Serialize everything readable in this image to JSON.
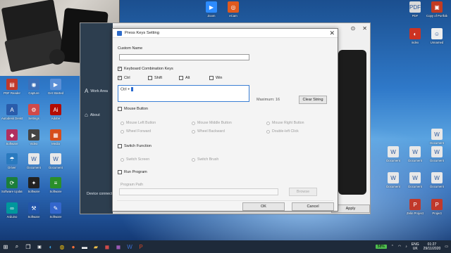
{
  "desktop": {
    "left_icons": [
      {
        "label": "PDF Reader",
        "color": "#c0392b",
        "glyph": "▤"
      },
      {
        "label": "Capture",
        "color": "#3d6fb8",
        "glyph": "◉"
      },
      {
        "label": "Get Started",
        "color": "#5b8fd6",
        "glyph": "▶"
      },
      {
        "label": "Autodesk Desktop App",
        "color": "#2a5caa",
        "glyph": "A"
      },
      {
        "label": "Settings",
        "color": "#d04a4a",
        "glyph": "⚙"
      },
      {
        "label": "Adobe",
        "color": "#b30b00",
        "glyph": "Ai"
      },
      {
        "label": "Software",
        "color": "#b03060",
        "glyph": "◆"
      },
      {
        "label": "Video",
        "color": "#444444",
        "glyph": "▶"
      },
      {
        "label": "Media",
        "color": "#d64e1c",
        "glyph": "▦"
      },
      {
        "label": "Driver",
        "color": "#2a7abf",
        "glyph": "☂"
      },
      {
        "label": "Document",
        "color": "#e8e8e8",
        "glyph": "W"
      },
      {
        "label": "Document",
        "color": "#e8e8e8",
        "glyph": "W"
      },
      {
        "label": "Software Update",
        "color": "#1b7e3b",
        "glyph": "⟳"
      },
      {
        "label": "Software",
        "color": "#222222",
        "glyph": "✦"
      },
      {
        "label": "Software",
        "color": "#2a8f2a",
        "glyph": "≡"
      },
      {
        "label": "Arduino",
        "color": "#00979c",
        "glyph": "∞"
      },
      {
        "label": "Software",
        "color": "#2255aa",
        "glyph": "⚒"
      },
      {
        "label": "Software",
        "color": "#3366cc",
        "glyph": "✎"
      }
    ],
    "right_icons": [
      {
        "label": "Zoom",
        "color": "#2d8cff",
        "glyph": "▶"
      },
      {
        "label": "eCam",
        "color": "#e05a1e",
        "glyph": "◎"
      },
      {
        "label": "PDF",
        "color": "#d9d9d9",
        "glyph": "PDF"
      },
      {
        "label": "Copy of Portfolio",
        "color": "#c23b22",
        "glyph": "▣"
      },
      {
        "label": "index",
        "color": "#cc3322",
        "glyph": "◐"
      },
      {
        "label": "Unnamed",
        "color": "#eeeeee",
        "glyph": "☺"
      },
      {
        "label": "Document",
        "color": "#e8e8e8",
        "glyph": "W"
      },
      {
        "label": "Document",
        "color": "#e8e8e8",
        "glyph": "W"
      },
      {
        "label": "Document",
        "color": "#e8e8e8",
        "glyph": "W"
      },
      {
        "label": "Document",
        "color": "#e8e8e8",
        "glyph": "W"
      },
      {
        "label": "Document",
        "color": "#e8e8e8",
        "glyph": "W"
      },
      {
        "label": "Document",
        "color": "#e8e8e8",
        "glyph": "W"
      },
      {
        "label": "Zelin Project",
        "color": "#c0392b",
        "glyph": "P"
      },
      {
        "label": "Project",
        "color": "#c0392b",
        "glyph": "P"
      },
      {
        "label": "Document",
        "color": "#e8e8e8",
        "glyph": "W"
      }
    ]
  },
  "background_app": {
    "sidebar_items": [
      {
        "label": "Work Area",
        "icon": "work-area-icon",
        "glyph": "A"
      },
      {
        "label": "About",
        "icon": "home-icon",
        "glyph": "⌂"
      }
    ],
    "footer_text": "Device connect",
    "apply_label": "Apply"
  },
  "dialog": {
    "title": "Press Keys Setting",
    "custom_name": {
      "label": "Custom Name",
      "value": ""
    },
    "keyboard_combo": {
      "label": "Keyboard Combination Keys",
      "modifiers": [
        {
          "label": "Ctrl",
          "checked": true
        },
        {
          "label": "Shift",
          "checked": false
        },
        {
          "label": "Alt",
          "checked": false
        },
        {
          "label": "Win",
          "checked": false
        }
      ],
      "value": "Ctrl + ",
      "maximum_text": "Maximum: 16",
      "clear_label": "Clear String"
    },
    "mouse_button": {
      "label": "Mouse Button",
      "options": [
        "Mouse Left Button",
        "Mouse Middle Button",
        "Mouse Right Button",
        "Wheel Forward",
        "Wheel Backward",
        "Double-left Click"
      ]
    },
    "switch_function": {
      "label": "Switch Function",
      "options": [
        "Switch Screen",
        "Switch Brush"
      ]
    },
    "run_program": {
      "label": "Run Program",
      "path_label": "Program Path",
      "browse_label": "Browse"
    },
    "ok_label": "OK",
    "cancel_label": "Cancel"
  },
  "taskbar": {
    "battery": "58%",
    "language": "ENG",
    "region": "UK",
    "time": "01:27",
    "date": "29/11/2020"
  }
}
